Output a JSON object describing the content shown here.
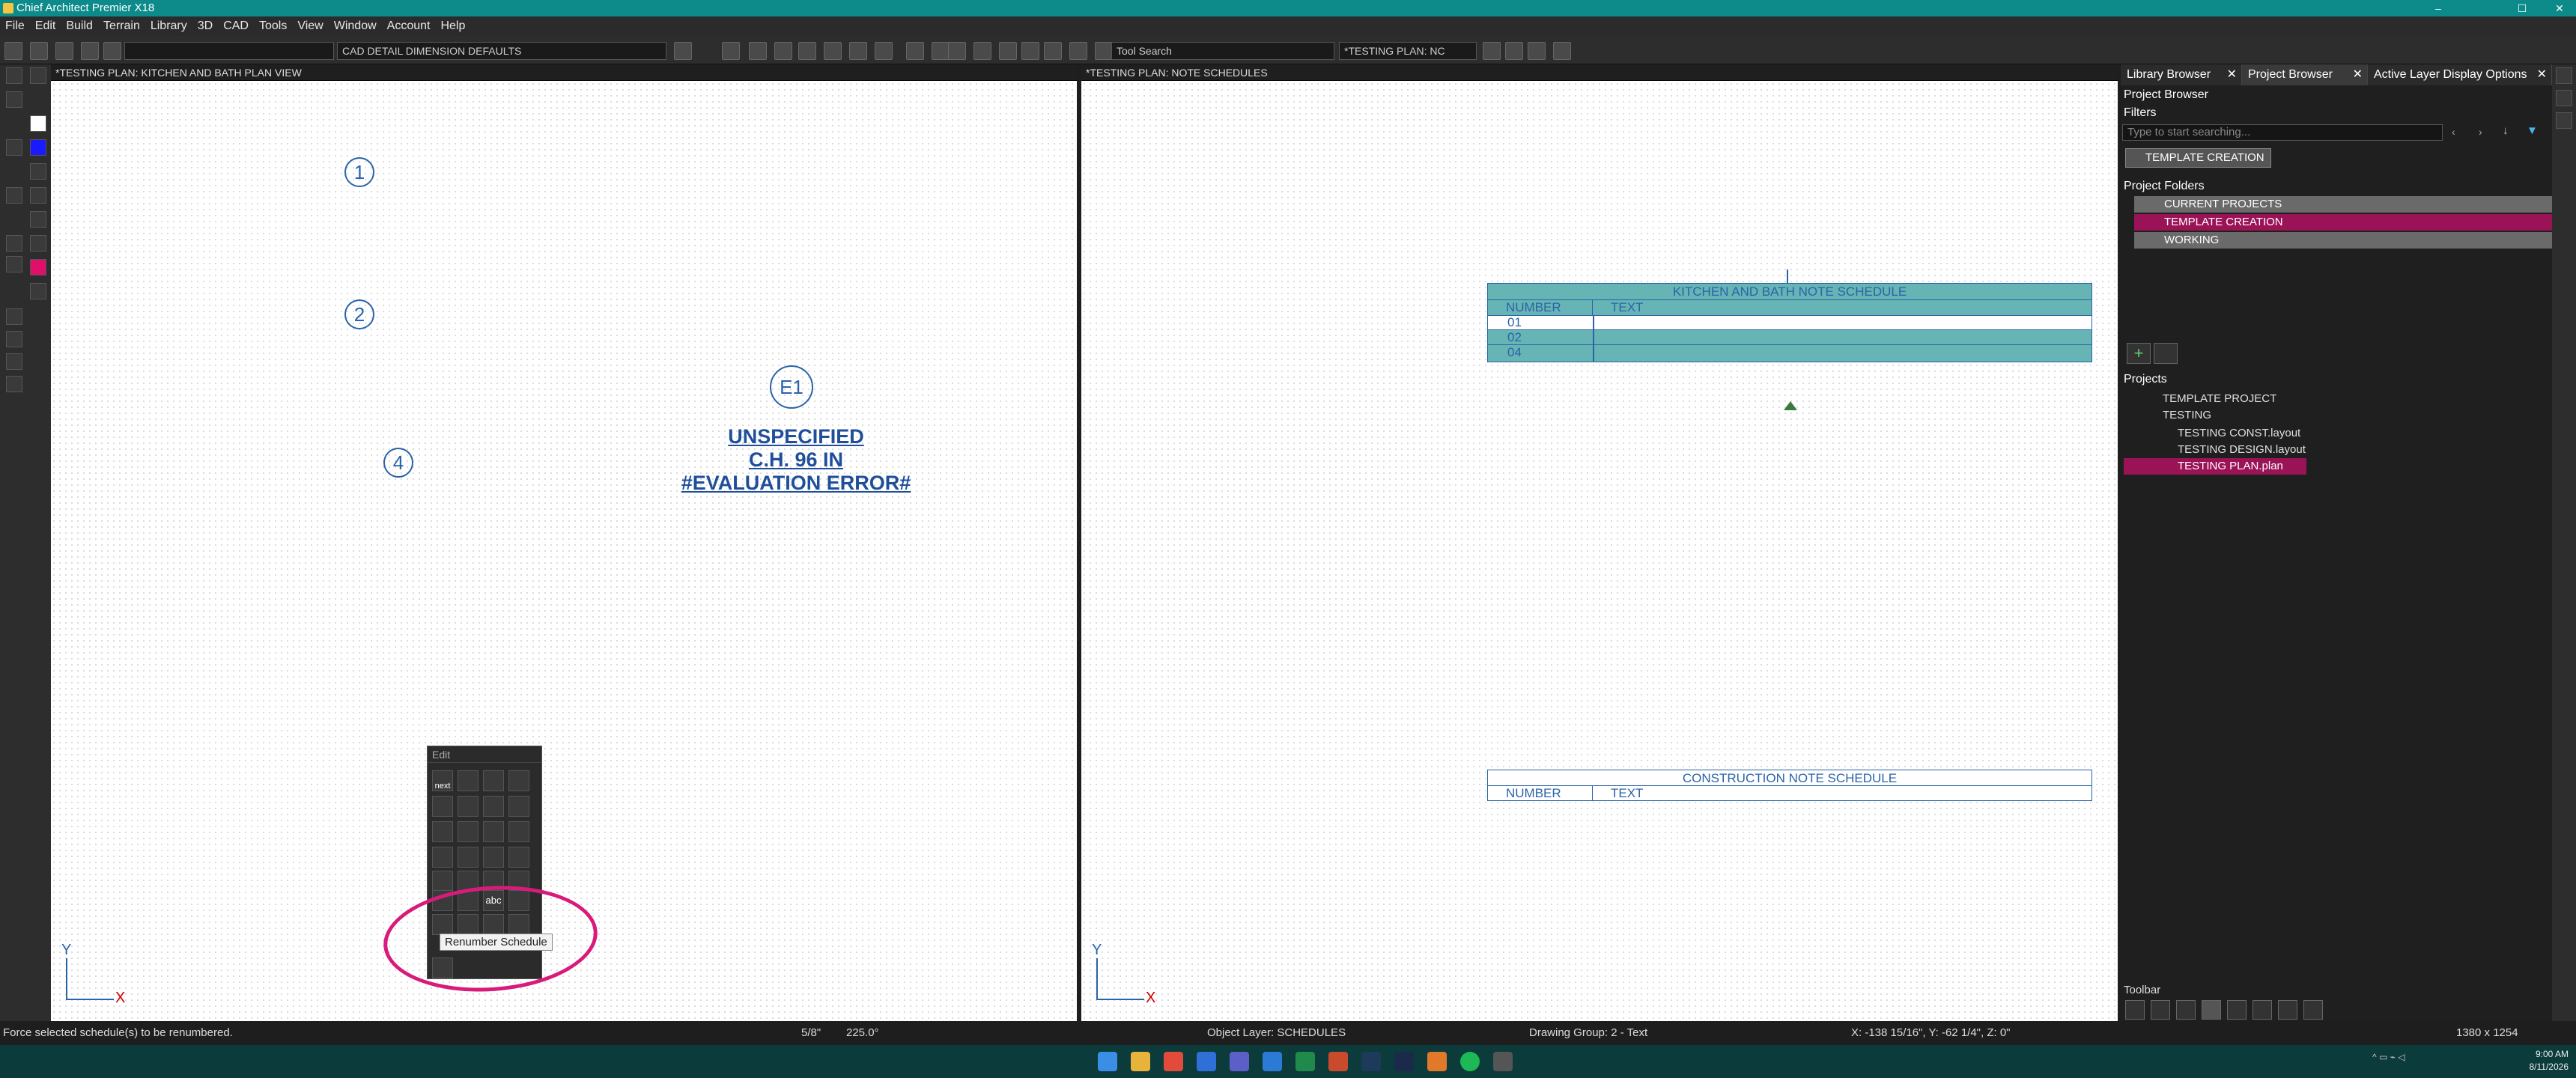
{
  "app": {
    "title": "Chief Architect Premier X18",
    "minimize": "–",
    "maximize": "☐",
    "close": "✕"
  },
  "menu": [
    "File",
    "Edit",
    "Build",
    "Terrain",
    "Library",
    "3D",
    "CAD",
    "Tools",
    "View",
    "Window",
    "Account",
    "Help"
  ],
  "toolbar": {
    "layer_set": "CAD DETAIL DIMENSION DEFAULTS",
    "tool_search_placeholder": "Tool Search",
    "view_select": "*TESTING PLAN: NC"
  },
  "left_pane": {
    "title": "*TESTING PLAN: KITCHEN AND BATH PLAN VIEW",
    "bubbles": [
      "1",
      "2",
      "4"
    ],
    "elevation_marker": "E1",
    "error_text": [
      "UNSPECIFIED",
      "C.H. 96 IN",
      "#EVALUATION ERROR#"
    ],
    "axis_y": "Y",
    "axis_x": "X"
  },
  "edit_palette": {
    "title": "Edit",
    "next_label": "next",
    "abc_label": "abc",
    "tooltip": "Renumber Schedule"
  },
  "right_pane": {
    "title": "*TESTING PLAN: NOTE SCHEDULES",
    "schedule1": {
      "title": "KITCHEN AND BATH NOTE SCHEDULE",
      "col_number": "NUMBER",
      "col_text": "TEXT",
      "rows": [
        "01",
        "02",
        "04"
      ]
    },
    "schedule2": {
      "title": "CONSTRUCTION NOTE SCHEDULE",
      "col_number": "NUMBER",
      "col_text": "TEXT"
    },
    "axis_y": "Y",
    "axis_x": "X"
  },
  "side_panel": {
    "tabs": [
      "Library Browser",
      "Project Browser",
      "Active Layer Display Options"
    ],
    "heading": "Project Browser",
    "filters_label": "Filters",
    "search_placeholder": "Type to start searching...",
    "filter_chip": "TEMPLATE CREATION",
    "project_folders_label": "Project Folders",
    "folders": [
      "CURRENT PROJECTS",
      "TEMPLATE CREATION",
      "WORKING"
    ],
    "projects_label": "Projects",
    "projects": [
      "TEMPLATE PROJECT",
      "TESTING",
      "TESTING CONST.layout",
      "TESTING DESIGN.layout",
      "TESTING PLAN.plan"
    ],
    "toolbar_label": "Toolbar",
    "size_readout": "1380 x 1254"
  },
  "status_bar": {
    "message": "Force selected schedule(s) to be renumbered.",
    "scale": "5/8\"",
    "angle": "225.0°",
    "object_layer": "Object Layer: SCHEDULES",
    "drawing_group": "Drawing Group: 2 - Text",
    "coords": "X: -138 15/16\", Y: -62 1/4\", Z: 0\""
  },
  "taskbar": {
    "time": "9:00 AM",
    "date": "8/11/2026"
  },
  "colors": {
    "accent_teal": "#0d8a8a",
    "highlight_magenta": "#9b1357",
    "schedule_blue": "#2a63a8",
    "schedule_selected": "#67b4b4",
    "annotation_circle": "#d81b7a"
  }
}
